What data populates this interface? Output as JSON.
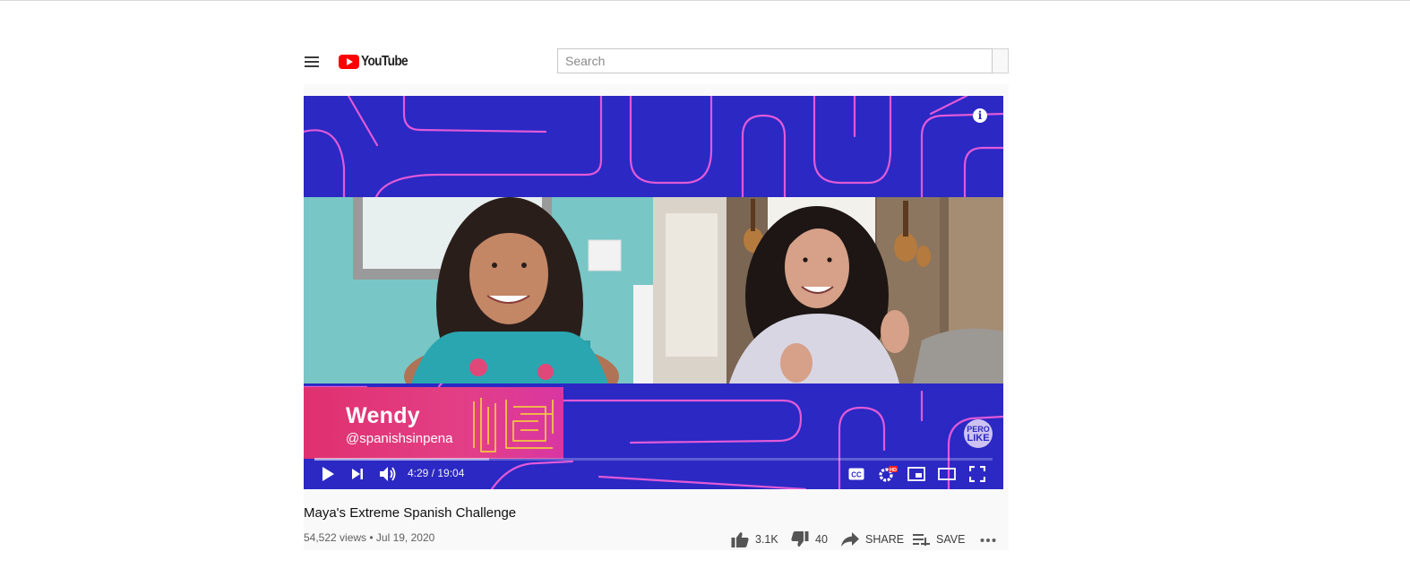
{
  "header": {
    "logo_text": "YouTube",
    "search_placeholder": "Search"
  },
  "player": {
    "lower_third": {
      "name": "Wendy",
      "handle": "@spanishsinpena"
    },
    "channel_badge": [
      "PERO",
      "LIKE"
    ],
    "time_display": "4:29 / 19:04",
    "progress": {
      "played_fraction": 0.0,
      "loaded_fraction": 0.257
    },
    "hd_badge": "HD"
  },
  "video": {
    "title": "Maya's Extreme Spanish Challenge",
    "meta": "54,522 views • Jul 19, 2020",
    "likes": "3.1K",
    "dislikes": "40",
    "share_label": "SHARE",
    "save_label": "SAVE"
  },
  "colors": {
    "brand_red": "#ff0000",
    "player_blue": "#2b28c4",
    "line_pink": "#e05ad8",
    "lower_third_pink": "#e0306f",
    "text_primary": "#0f0f0f",
    "text_secondary": "#606060"
  },
  "icons": [
    "menu-icon",
    "youtube-logo-icon",
    "info-icon",
    "play-icon",
    "next-icon",
    "volume-icon",
    "cc-icon",
    "settings-icon",
    "miniplayer-icon",
    "theater-icon",
    "fullscreen-icon",
    "thumb-up-icon",
    "thumb-down-icon",
    "share-icon",
    "save-icon",
    "more-icon"
  ]
}
